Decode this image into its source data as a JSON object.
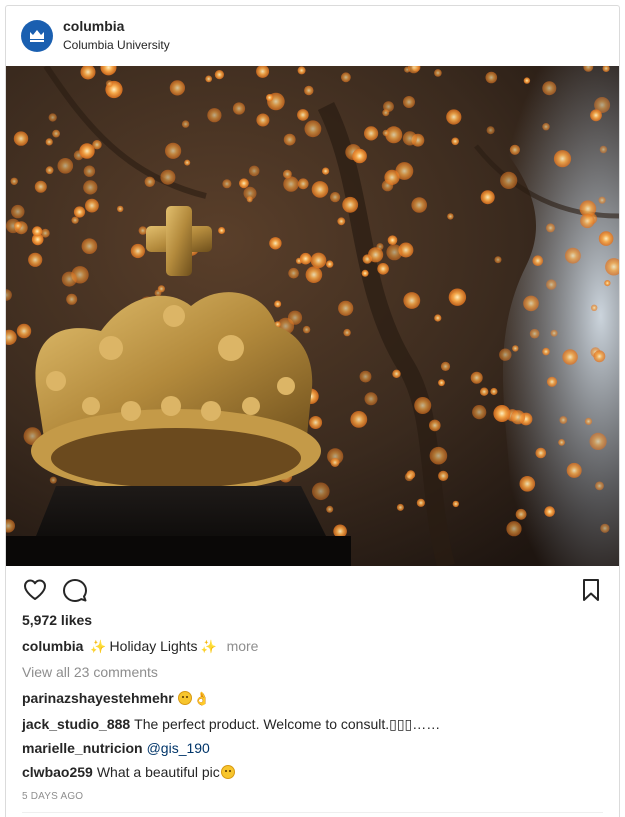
{
  "post": {
    "username": "columbia",
    "location": "Columbia University",
    "likes": "5,972 likes",
    "caption": {
      "user": "columbia",
      "text": "Holiday Lights",
      "more": "more"
    },
    "view_all_comments": "View all 23 comments",
    "comments": [
      {
        "user": "parinazshayestehmehr",
        "text": ""
      },
      {
        "user": "jack_studio_888",
        "text": "The perfect product. Welcome to consult.▯▯▯……"
      },
      {
        "user": "marielle_nutricion",
        "text": "@gis_190"
      },
      {
        "user": "clwbao259",
        "text": "What a beautiful pic"
      }
    ],
    "timestamp": "5 DAYS AGO"
  },
  "icons": {
    "avatar": "columbia-crown-logo",
    "like": "heart-icon",
    "comment": "comment-bubble-icon",
    "save": "bookmark-icon"
  },
  "colors": {
    "text": "#262626",
    "muted": "#8e8e8e",
    "border": "#dbdbdb",
    "mention": "#003569"
  }
}
